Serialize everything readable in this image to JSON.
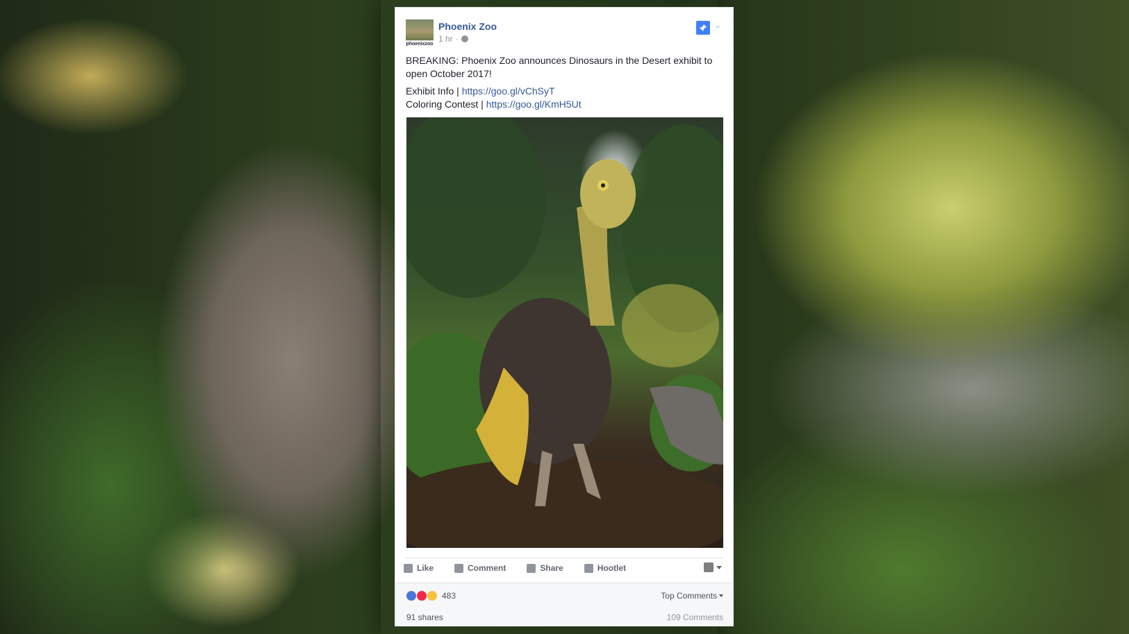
{
  "post": {
    "page_name": "Phoenix Zoo",
    "avatar_caption": "phoenixzoo",
    "time": "1 hr",
    "separator": "·",
    "text_line": "BREAKING: Phoenix Zoo announces Dinosaurs in the Desert exhibit to open October 2017!",
    "exhibit_label": "Exhibit Info | ",
    "exhibit_link": "https://goo.gl/vChSyT",
    "coloring_label": "Coloring Contest | ",
    "coloring_link": "https://goo.gl/KmH5Ut"
  },
  "actions": {
    "like": "Like",
    "comment": "Comment",
    "share": "Share",
    "hootlet": "Hootlet"
  },
  "reactions": {
    "count": "483",
    "sort_label": "Top Comments"
  },
  "footer": {
    "shares": "91 shares",
    "comments": "109 Comments"
  },
  "colors": {
    "link": "#365899",
    "pin": "#4080ff"
  }
}
